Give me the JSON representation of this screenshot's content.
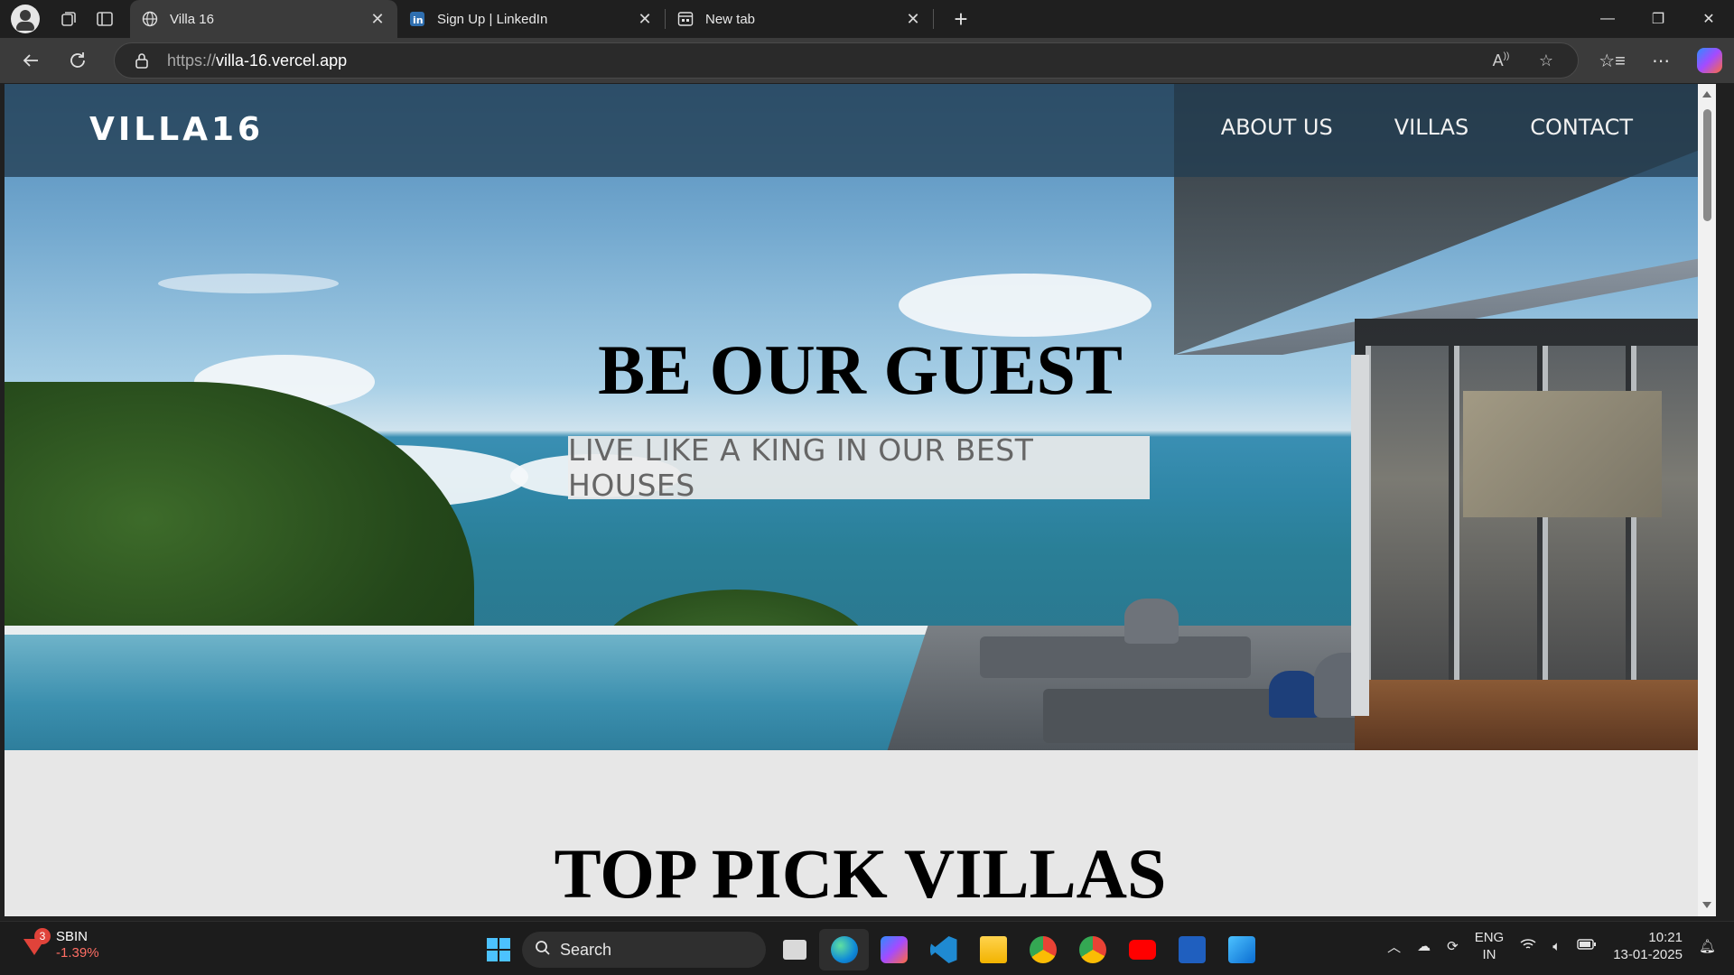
{
  "browser": {
    "tabs": [
      {
        "title": "Villa 16",
        "active": true,
        "icon": "globe-icon"
      },
      {
        "title": "Sign Up | LinkedIn",
        "active": false,
        "icon": "linkedin-icon"
      },
      {
        "title": "New tab",
        "active": false,
        "icon": "newtab-icon"
      }
    ],
    "address": {
      "scheme": "https://",
      "host": "villa-16.vercel.app"
    }
  },
  "site": {
    "brand": "VILLA16",
    "nav": [
      "ABOUT US",
      "VILLAS",
      "CONTACT"
    ],
    "hero": {
      "title": "BE OUR GUEST",
      "tagline": "LIVE LIKE A KING IN OUR BEST HOUSES"
    },
    "section_title": "TOP PICK VILLAS"
  },
  "taskbar": {
    "stock": {
      "symbol": "SBIN",
      "change": "-1.39%",
      "badge": "3"
    },
    "search_placeholder": "Search",
    "language": {
      "line1": "ENG",
      "line2": "IN"
    },
    "clock": {
      "time": "10:21",
      "date": "13-01-2025"
    }
  },
  "colors": {
    "nav_overlay": "#233e52",
    "tagline_bg": "#ebebeb",
    "tagline_text": "#666666",
    "page_bg": "#e7e7e7",
    "stock_down": "#ff6e64"
  }
}
